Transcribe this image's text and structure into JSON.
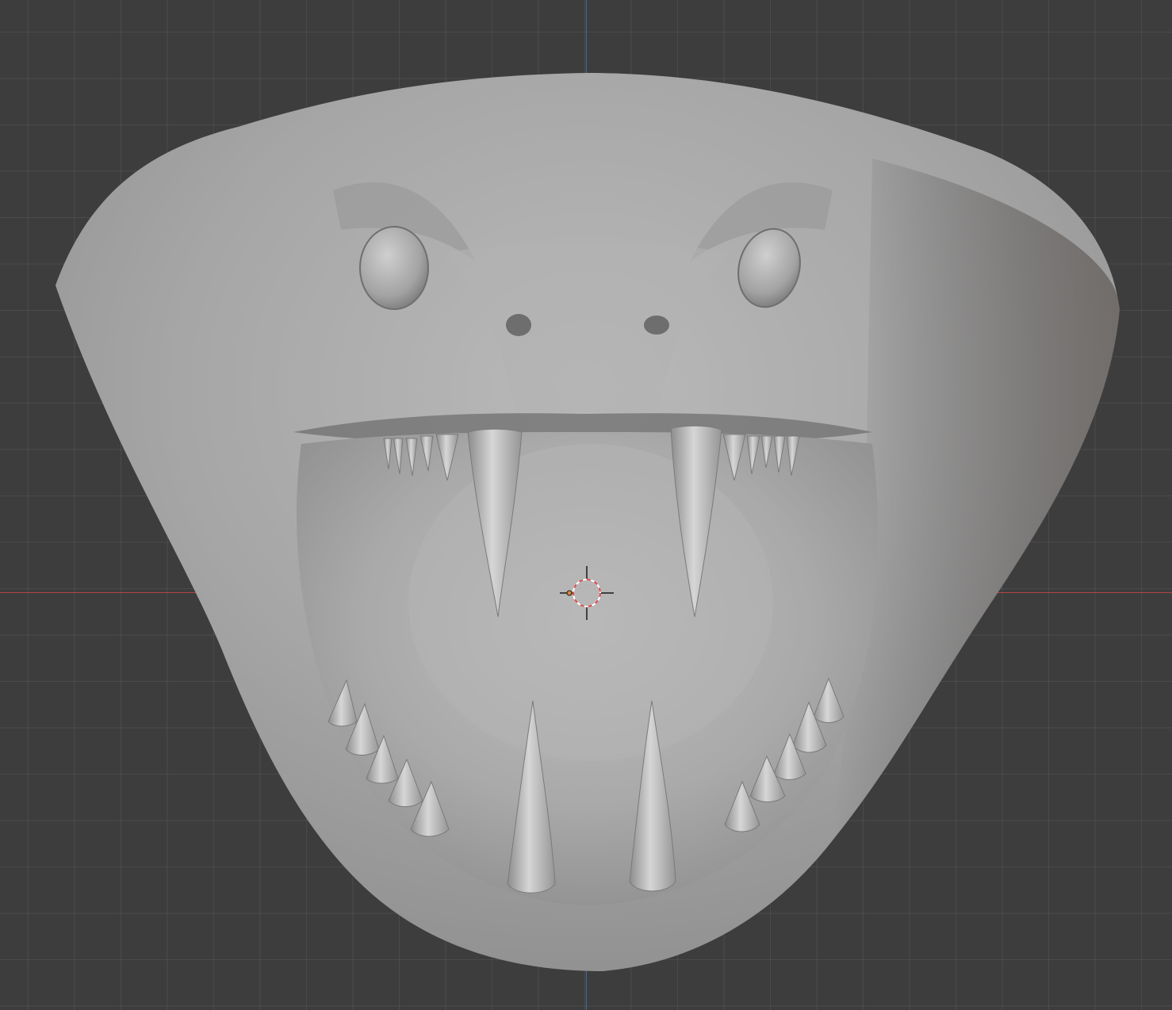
{
  "viewport": {
    "name": "3D Viewport",
    "background": "#3d3d3d",
    "grid_line": "#4a4a4a",
    "axis_x_color": "#b04545",
    "axis_y_color": "#3e6aa8"
  },
  "model": {
    "material_color": "#a9a9a9",
    "upper_small_teeth_per_side": 5,
    "upper_fangs": 2,
    "lower_small_teeth_per_side": 5,
    "lower_fangs": 2,
    "eyes": 2,
    "nostrils": 2
  },
  "cursor": {
    "icon": "3d-cursor-icon",
    "ring_colors": [
      "#e04a4a",
      "#ffffff"
    ]
  }
}
